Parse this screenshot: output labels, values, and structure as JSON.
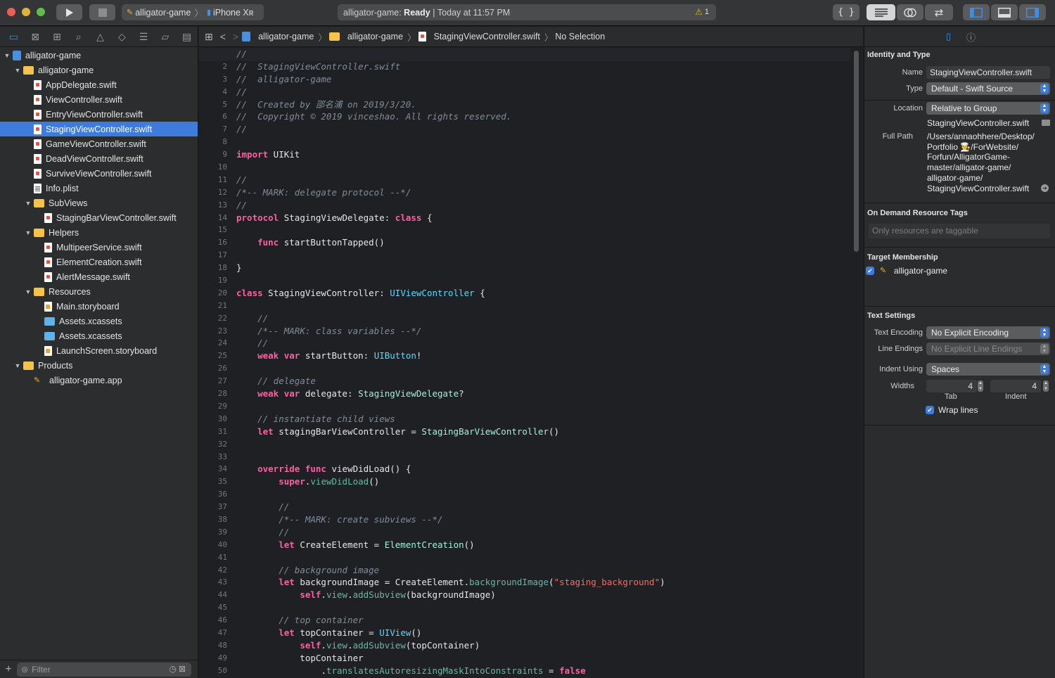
{
  "toolbar": {
    "scheme": {
      "project": "alligator-game",
      "device": "iPhone Xʀ"
    },
    "status": {
      "project": "alligator-game:",
      "state": "Ready",
      "separator": "|",
      "time": "Today at 11:57 PM",
      "warnings": "1"
    }
  },
  "navigator": {
    "filter_placeholder": "Filter",
    "items": [
      {
        "label": "alligator-game",
        "kind": "project",
        "depth": 0,
        "disclosure": "open"
      },
      {
        "label": "alligator-game",
        "kind": "folder",
        "depth": 1,
        "disclosure": "open"
      },
      {
        "label": "AppDelegate.swift",
        "kind": "swift",
        "depth": 2
      },
      {
        "label": "ViewController.swift",
        "kind": "swift",
        "depth": 2
      },
      {
        "label": "EntryViewController.swift",
        "kind": "swift",
        "depth": 2
      },
      {
        "label": "StagingViewController.swift",
        "kind": "swift",
        "depth": 2,
        "selected": true
      },
      {
        "label": "GameViewController.swift",
        "kind": "swift",
        "depth": 2
      },
      {
        "label": "DeadViewController.swift",
        "kind": "swift",
        "depth": 2
      },
      {
        "label": "SurviveViewController.swift",
        "kind": "swift",
        "depth": 2
      },
      {
        "label": "Info.plist",
        "kind": "plist",
        "depth": 2
      },
      {
        "label": "SubViews",
        "kind": "folder",
        "depth": 2,
        "disclosure": "open"
      },
      {
        "label": "StagingBarViewController.swift",
        "kind": "swift",
        "depth": 3
      },
      {
        "label": "Helpers",
        "kind": "folder",
        "depth": 2,
        "disclosure": "open"
      },
      {
        "label": "MultipeerService.swift",
        "kind": "swift",
        "depth": 3
      },
      {
        "label": "ElementCreation.swift",
        "kind": "swift",
        "depth": 3
      },
      {
        "label": "AlertMessage.swift",
        "kind": "swift",
        "depth": 3
      },
      {
        "label": "Resources",
        "kind": "folder",
        "depth": 2,
        "disclosure": "open"
      },
      {
        "label": "Main.storyboard",
        "kind": "story",
        "depth": 3
      },
      {
        "label": "Assets.xcassets",
        "kind": "blue-folder",
        "depth": 3
      },
      {
        "label": "Assets.xcassets",
        "kind": "blue-folder",
        "depth": 3
      },
      {
        "label": "LaunchScreen.storyboard",
        "kind": "story",
        "depth": 3
      },
      {
        "label": "Products",
        "kind": "folder",
        "depth": 1,
        "disclosure": "open"
      },
      {
        "label": "alligator-game.app",
        "kind": "app",
        "depth": 2
      }
    ]
  },
  "jumpbar": {
    "crumbs": [
      "alligator-game",
      "alligator-game",
      "StagingViewController.swift",
      "No Selection"
    ]
  },
  "editor": {
    "current_line": 1,
    "lines": [
      [
        [
          "cm",
          "//"
        ]
      ],
      [
        [
          "cm",
          "//  StagingViewController.swift"
        ]
      ],
      [
        [
          "cm",
          "//  alligator-game"
        ]
      ],
      [
        [
          "cm",
          "//"
        ]
      ],
      [
        [
          "cm",
          "//  Created by 邵名浦 on 2019/3/20."
        ]
      ],
      [
        [
          "cm",
          "//  Copyright © 2019 vinceshao. All rights reserved."
        ]
      ],
      [
        [
          "cm",
          "//"
        ]
      ],
      [],
      [
        [
          "kw",
          "import"
        ],
        [
          "pl",
          " UIKit"
        ]
      ],
      [],
      [
        [
          "cm",
          "//"
        ]
      ],
      [
        [
          "cm",
          "/*-- MARK: delegate protocol --*/"
        ]
      ],
      [
        [
          "cm",
          "//"
        ]
      ],
      [
        [
          "kw",
          "protocol"
        ],
        [
          "pl",
          " StagingViewDelegate: "
        ],
        [
          "kw",
          "class"
        ],
        [
          "pl",
          " {"
        ]
      ],
      [],
      [
        [
          "pl",
          "    "
        ],
        [
          "kw",
          "func"
        ],
        [
          "pl",
          " startButtonTapped()"
        ]
      ],
      [],
      [
        [
          "pl",
          "}"
        ]
      ],
      [],
      [
        [
          "kw",
          "class"
        ],
        [
          "pl",
          " StagingViewController: "
        ],
        [
          "ty",
          "UIViewController"
        ],
        [
          "pl",
          " {"
        ]
      ],
      [],
      [
        [
          "pl",
          "    "
        ],
        [
          "cm",
          "//"
        ]
      ],
      [
        [
          "pl",
          "    "
        ],
        [
          "cm",
          "/*-- MARK: class variables --*/"
        ]
      ],
      [
        [
          "pl",
          "    "
        ],
        [
          "cm",
          "//"
        ]
      ],
      [
        [
          "pl",
          "    "
        ],
        [
          "kw",
          "weak var"
        ],
        [
          "pl",
          " startButton: "
        ],
        [
          "ty",
          "UIButton"
        ],
        [
          "pl",
          "!"
        ]
      ],
      [],
      [
        [
          "pl",
          "    "
        ],
        [
          "cm",
          "// delegate"
        ]
      ],
      [
        [
          "pl",
          "    "
        ],
        [
          "kw",
          "weak var"
        ],
        [
          "pl",
          " delegate: "
        ],
        [
          "cls",
          "StagingViewDelegate"
        ],
        [
          "pl",
          "?"
        ]
      ],
      [],
      [
        [
          "pl",
          "    "
        ],
        [
          "cm",
          "// instantiate child views"
        ]
      ],
      [
        [
          "pl",
          "    "
        ],
        [
          "kw",
          "let"
        ],
        [
          "pl",
          " stagingBarViewController = "
        ],
        [
          "cls",
          "StagingBarViewController"
        ],
        [
          "pl",
          "()"
        ]
      ],
      [],
      [],
      [
        [
          "pl",
          "    "
        ],
        [
          "kw",
          "override func"
        ],
        [
          "pl",
          " viewDidLoad() {"
        ]
      ],
      [
        [
          "pl",
          "        "
        ],
        [
          "kw",
          "super"
        ],
        [
          "pl",
          "."
        ],
        [
          "fn",
          "viewDidLoad"
        ],
        [
          "pl",
          "()"
        ]
      ],
      [],
      [
        [
          "pl",
          "        "
        ],
        [
          "cm",
          "//"
        ]
      ],
      [
        [
          "pl",
          "        "
        ],
        [
          "cm",
          "/*-- MARK: create subviews --*/"
        ]
      ],
      [
        [
          "pl",
          "        "
        ],
        [
          "cm",
          "//"
        ]
      ],
      [
        [
          "pl",
          "        "
        ],
        [
          "kw",
          "let"
        ],
        [
          "pl",
          " CreateElement = "
        ],
        [
          "cls",
          "ElementCreation"
        ],
        [
          "pl",
          "()"
        ]
      ],
      [],
      [
        [
          "pl",
          "        "
        ],
        [
          "cm",
          "// background image"
        ]
      ],
      [
        [
          "pl",
          "        "
        ],
        [
          "kw",
          "let"
        ],
        [
          "pl",
          " backgroundImage = CreateElement."
        ],
        [
          "fn",
          "backgroundImage"
        ],
        [
          "pl",
          "("
        ],
        [
          "str",
          "\"staging_background\""
        ],
        [
          "pl",
          ")"
        ]
      ],
      [
        [
          "pl",
          "            "
        ],
        [
          "kw",
          "self"
        ],
        [
          "pl",
          "."
        ],
        [
          "fn",
          "view"
        ],
        [
          "pl",
          "."
        ],
        [
          "fn",
          "addSubview"
        ],
        [
          "pl",
          "(backgroundImage)"
        ]
      ],
      [],
      [
        [
          "pl",
          "        "
        ],
        [
          "cm",
          "// top container"
        ]
      ],
      [
        [
          "pl",
          "        "
        ],
        [
          "kw",
          "let"
        ],
        [
          "pl",
          " topContainer = "
        ],
        [
          "ty",
          "UIView"
        ],
        [
          "pl",
          "()"
        ]
      ],
      [
        [
          "pl",
          "            "
        ],
        [
          "kw",
          "self"
        ],
        [
          "pl",
          "."
        ],
        [
          "fn",
          "view"
        ],
        [
          "pl",
          "."
        ],
        [
          "fn",
          "addSubview"
        ],
        [
          "pl",
          "(topContainer)"
        ]
      ],
      [
        [
          "pl",
          "            topContainer"
        ]
      ],
      [
        [
          "pl",
          "                ."
        ],
        [
          "fn",
          "translatesAutoresizingMaskIntoConstraints"
        ],
        [
          "pl",
          " = "
        ],
        [
          "kw",
          "false"
        ]
      ]
    ]
  },
  "inspector": {
    "identity": {
      "title": "Identity and Type",
      "name_label": "Name",
      "name_value": "StagingViewController.swift",
      "type_label": "Type",
      "type_value": "Default - Swift Source",
      "location_label": "Location",
      "location_value": "Relative to Group",
      "location_file": "StagingViewController.swift",
      "fullpath_label": "Full Path",
      "fullpath_lines": [
        "/Users/annaohhere/Desktop/",
        "Portfolio 🧑‍🍳/ForWebsite/",
        "Forfun/AlligatorGame-",
        "master/alligator-game/",
        "alligator-game/",
        "StagingViewController.swift"
      ]
    },
    "tags": {
      "title": "On Demand Resource Tags",
      "placeholder": "Only resources are taggable"
    },
    "membership": {
      "title": "Target Membership",
      "target": "alligator-game",
      "checked": true
    },
    "text": {
      "title": "Text Settings",
      "encoding_label": "Text Encoding",
      "encoding_value": "No Explicit Encoding",
      "endings_label": "Line Endings",
      "endings_value": "No Explicit Line Endings",
      "indent_label": "Indent Using",
      "indent_value": "Spaces",
      "widths_label": "Widths",
      "tab_value": "4",
      "indent_width_value": "4",
      "tab_caption": "Tab",
      "indent_caption": "Indent",
      "wrap_label": "Wrap lines",
      "wrap_checked": true
    }
  },
  "colors": {
    "accent": "#3d7bdc",
    "keyword": "#fc5fa3",
    "comment": "#7f8c98",
    "type": "#5dd8ff",
    "string": "#fc6a5d"
  }
}
